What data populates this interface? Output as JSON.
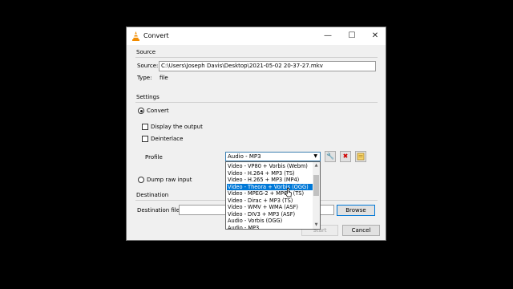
{
  "window": {
    "title": "Convert"
  },
  "source": {
    "group_label": "Source",
    "source_label": "Source:",
    "source_value": "C:\\Users\\Joseph Davis\\Desktop\\2021-05-02 20-37-27.mkv",
    "type_label": "Type:",
    "type_value": "file"
  },
  "settings": {
    "group_label": "Settings",
    "convert_label": "Convert",
    "display_output_label": "Display the output",
    "deinterlace_label": "Deinterlace",
    "profile_label": "Profile",
    "profile_selected": "Audio - MP3",
    "dump_raw_label": "Dump raw input"
  },
  "profile_options": [
    "Video - VP80 + Vorbis (Webm)",
    "Video - H.264 + MP3 (TS)",
    "Video - H.265 + MP3 (MP4)",
    "Video - Theora + Vorbis (OGG)",
    "Video - MPEG-2 + MPGA (TS)",
    "Video - Dirac + MP3 (TS)",
    "Video - WMV + WMA (ASF)",
    "Video - DIV3 + MP3 (ASF)",
    "Audio - Vorbis (OGG)",
    "Audio - MP3"
  ],
  "selected_option_index": 3,
  "destination": {
    "group_label": "Destination",
    "file_label": "Destination file:",
    "file_value": "",
    "browse_label": "Browse"
  },
  "footer": {
    "start_label": "Start",
    "cancel_label": "Cancel"
  }
}
